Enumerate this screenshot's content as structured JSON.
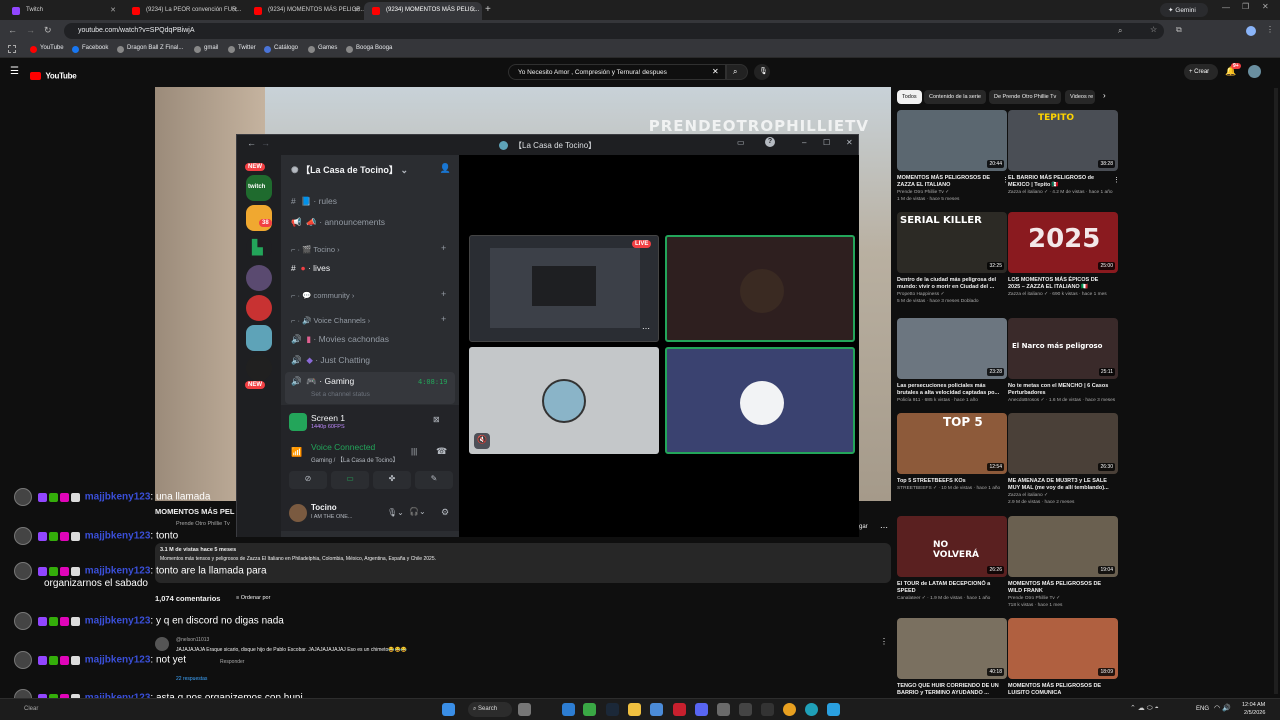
{
  "browser": {
    "tabs": [
      {
        "label": "Twitch",
        "color": "#9146ff"
      },
      {
        "label": "(9234) La PEOR convención FUR...",
        "color": "#ff0000"
      },
      {
        "label": "(9234) MOMENTOS MÁS PELIGR...",
        "color": "#ff0000"
      },
      {
        "label": "(9234) MOMENTOS MÁS PELIG...",
        "color": "#ff0000"
      }
    ],
    "gemini": "Gemini",
    "url": "youtube.com/watch?v=SPQdqPBiwjA",
    "bookmarks": [
      "YouTube",
      "Facebook",
      "Dragon Ball Z Final...",
      "gmail",
      "Twitter",
      "Catálogo",
      "Games",
      "Booga Booga"
    ]
  },
  "youtube": {
    "logo": "YouTube",
    "search_value": "Yo Necesito Amor , Compresión y Ternura! despues",
    "create": "Crear",
    "notif_count": "9+",
    "watermark": "PRENDEOTROPHILLIETV",
    "below": {
      "title_frag": "MOMENTOS MÁS PEL",
      "channel_frag": "Prende Otro Phillie Tv",
      "views_frag": "3.1 M de vistas  hace 5 meses",
      "desc": "Momentos más tensos y peligrosos de Zazza El Italiano en Philadelphia, Colombia, México, Argentina, España y Chile 2025.",
      "comments_count": "1,074 comentarios",
      "sort": "Ordenar por",
      "comment_user": "@nelson11013",
      "comment_text": "JAJAJAJAJA Eraque sicario, disque hijo de Pablo Escobar. JAJAJAJAJAJAJ Eso es un chimeto😂😂😂",
      "reply": "Responder",
      "replies": "22 respuestas",
      "share_frag": "gar"
    },
    "chips": [
      "Todos",
      "Contenido de la serie",
      "De Prende Otro Phillie Tv",
      "Videos re"
    ],
    "cards": [
      {
        "title": "MOMENTOS MÁS PELIGROSOS DE ZAZZA EL ITALIANO",
        "channel": "Prende Otro Phillie Tv ✓",
        "meta": "1 M de vistas · hace 5 meses",
        "duration": "20:44",
        "color": "#5b6770",
        "overlay": ""
      },
      {
        "title": "EL BARRIO MÁS PELIGROSO de MEXICO | Tepito 🇲🇽",
        "channel": "Zazza el italiano ✓ · 4.2 M de vistas · hace 1 año",
        "meta": "",
        "duration": "38:28",
        "color": "#4a4e55",
        "overlay": "TEPITO"
      },
      {
        "title": "Dentro de la ciudad más peligrosa del mundo: vivir o morir en Ciudad del ...",
        "channel": "Propetto Happiness ✓",
        "meta": "5 M de vistas · hace 3 meses  Doblado",
        "duration": "32:25",
        "color": "#2c2a25",
        "overlay": "SERIAL KILLER"
      },
      {
        "title": "LOS MOMENTOS MÁS ÉPICOS DE 2025 – ZAZZA EL ITALIANO 🇮🇹",
        "channel": "Zazza el italiano ✓ · 690 k vistas · hace 1 mes",
        "meta": "",
        "duration": "25:00",
        "color": "#8a1a1f",
        "overlay": "2025"
      },
      {
        "title": "Las persecuciones policiales más brutales a alta velocidad captadas po...",
        "channel": "Policía 911 · 685 k vistas · hace 1 año",
        "meta": "",
        "duration": "23:28",
        "color": "#6c7680",
        "overlay": ""
      },
      {
        "title": "No te metas con el MENCHO | 6 Casos Perturbadores",
        "channel": "AnecdoBrosos ✓ · 1.6 M de vistas · hace 3 meses",
        "meta": "",
        "duration": "25:11",
        "color": "#3a2a2a",
        "overlay": "El Narco más peligroso"
      },
      {
        "title": "Top 5 STREETBEEFS KOs",
        "channel": "STREETBEEFS ✓ · 10 M de vistas · hace 1 año",
        "meta": "",
        "duration": "12:54",
        "color": "#8d5a3a",
        "overlay": "TOP 5"
      },
      {
        "title": "ME AMENAZA DE MU3RT3 y LE SALE MUY MAL (me voy de allí temblando)...",
        "channel": "Zazza el italiano ✓",
        "meta": "2.9 M de vistas · hace 2 meses",
        "duration": "26:30",
        "color": "#4a4038",
        "overlay": ""
      },
      {
        "title": "El TOUR de LATAM DECEPCIONÓ a SPEED",
        "channel": "Canalateer ✓ · 1.9 M de vistas · hace 1 año",
        "meta": "",
        "duration": "26:26",
        "color": "#5a2020",
        "overlay": "NO VOLVERÁ"
      },
      {
        "title": "MOMENTOS MÁS PELIGROSOS DE WILD FRANK",
        "channel": "Prende Otro Phillie Tv ✓",
        "meta": "718 k vistas · hace 1 mes",
        "duration": "19:04",
        "color": "#6a6050",
        "overlay": ""
      },
      {
        "title": "TENGO QUE HUIR CORRIENDO DE UN BARRIO y TERMINO AYUDANDO ...",
        "channel": "",
        "meta": "",
        "duration": "40:18",
        "color": "#7a7060",
        "overlay": ""
      },
      {
        "title": "MOMENTOS MÁS PELIGROSOS DE LUISITO COMUNICA",
        "channel": "",
        "meta": "",
        "duration": "18:09",
        "color": "#b06040",
        "overlay": ""
      }
    ]
  },
  "discord": {
    "window_title": "【La Casa de Tocino】",
    "server_name": "【La Casa de Tocino】",
    "new_badge": "NEW",
    "mention_count": "38",
    "channels": {
      "rules": "rules",
      "announcements": "announcements",
      "cat_tocino": "Tocino",
      "lives": "lives",
      "cat_community": "community",
      "cat_voice": "Voice Channels",
      "movies": "Movies cachondas",
      "chatting": "Just Chatting",
      "gaming": "Gaming",
      "gaming_time": "4:08:19",
      "status": "Set a channel status"
    },
    "screen": {
      "label": "Screen 1",
      "quality": "1440p 60FPS"
    },
    "voice": {
      "status": "Voice Connected",
      "detail": "Gaming / 【La Casa de Tocino】"
    },
    "user": {
      "name": "Tocino",
      "status": "I AM THE ONE..."
    },
    "live_badge": "LIVE"
  },
  "chat": [
    {
      "user": "majjbkeny123",
      "text": ": una llamada"
    },
    {
      "user": "majjbkeny123",
      "text": ": tonto"
    },
    {
      "user": "majjbkeny123",
      "text": ": tonto are la llamada para"
    },
    {
      "user": "",
      "text": "organizarnos el sabado"
    },
    {
      "user": "majjbkeny123",
      "text": ": y q en discord no digas nada"
    },
    {
      "user": "majjbkeny123",
      "text": ": not yet"
    },
    {
      "user": "majjbkeny123",
      "text": ": asta q nos organizemos con huni"
    }
  ],
  "chat_footer": "Clear",
  "taskbar": {
    "search": "Search",
    "lang": "ENG",
    "time": "12:04 AM",
    "date": "2/5/2026"
  }
}
